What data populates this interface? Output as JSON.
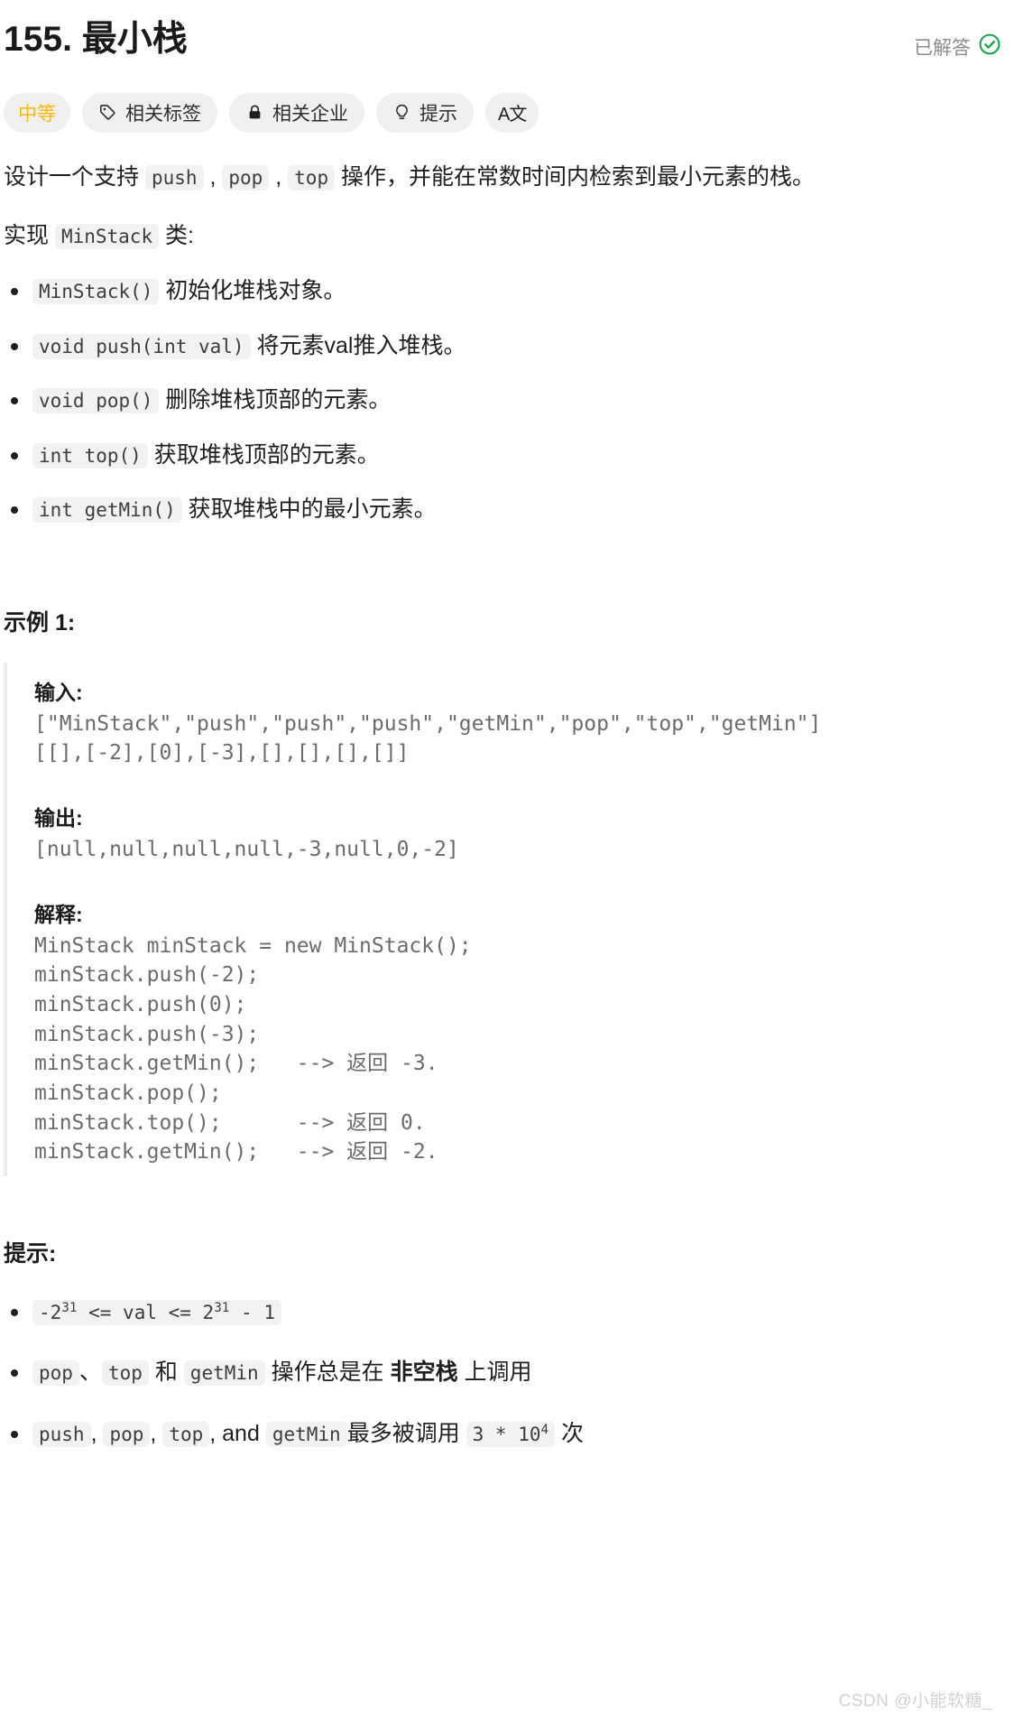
{
  "header": {
    "title": "155. 最小栈",
    "status_label": "已解答",
    "status_icon": "check-circle-icon",
    "status_color": "#16a34a"
  },
  "tags": [
    {
      "label": "中等",
      "icon": null,
      "name": "difficulty-badge",
      "color": "#ffb800"
    },
    {
      "label": "相关标签",
      "icon": "tag-icon",
      "name": "related-topics-button"
    },
    {
      "label": "相关企业",
      "icon": "lock-icon",
      "name": "related-companies-button"
    },
    {
      "label": "提示",
      "icon": "lightbulb-icon",
      "name": "hints-button"
    },
    {
      "label": "A文",
      "icon": "translate-icon",
      "name": "language-toggle-button"
    }
  ],
  "description": {
    "line1_pre": "设计一个支持 ",
    "code_push": "push",
    "sep1": " , ",
    "code_pop": "pop",
    "sep2": " , ",
    "code_top": "top",
    "line1_post": " 操作，并能在常数时间内检索到最小元素的栈。",
    "line2_pre": "实现 ",
    "code_minstack": "MinStack",
    "line2_post": " 类:"
  },
  "methods": [
    {
      "code": "MinStack()",
      "text": " 初始化堆栈对象。"
    },
    {
      "code": "void push(int val)",
      "text": " 将元素val推入堆栈。"
    },
    {
      "code": "void pop()",
      "text": " 删除堆栈顶部的元素。"
    },
    {
      "code": "int top()",
      "text": " 获取堆栈顶部的元素。"
    },
    {
      "code": "int getMin()",
      "text": " 获取堆栈中的最小元素。"
    }
  ],
  "example": {
    "heading": "示例 1:",
    "input_label": "输入:",
    "input_code": "[\"MinStack\",\"push\",\"push\",\"push\",\"getMin\",\"pop\",\"top\",\"getMin\"]\n[[],[-2],[0],[-3],[],[],[],[]]",
    "output_label": "输出:",
    "output_code": "[null,null,null,null,-3,null,0,-2]",
    "explanation_label": "解释:",
    "explanation_code": "MinStack minStack = new MinStack();\nminStack.push(-2);\nminStack.push(0);\nminStack.push(-3);\nminStack.getMin();   --> 返回 -3.\nminStack.pop();\nminStack.top();      --> 返回 0.\nminStack.getMin();   --> 返回 -2."
  },
  "hints": {
    "heading": "提示:",
    "item1": {
      "code_pre": "-2",
      "code_sup1": "31",
      "code_mid": " <= val <= 2",
      "code_sup2": "31",
      "code_post": " - 1"
    },
    "item2": {
      "code_pop": "pop",
      "t1": "、",
      "code_top": "top",
      "t2": " 和 ",
      "code_getmin": "getMin",
      "t3": " 操作总是在 ",
      "bold": "非空栈",
      "t4": " 上调用"
    },
    "item3": {
      "code_push": "push",
      "t1": ", ",
      "code_pop": "pop",
      "t2": ", ",
      "code_top": "top",
      "t3": ", and ",
      "code_getmin": "getMin",
      "t4": "最多被调用 ",
      "code_limit_pre": "3 * 10",
      "code_limit_sup": "4",
      "t5": " 次"
    }
  },
  "watermark": "CSDN @小能软糖_"
}
